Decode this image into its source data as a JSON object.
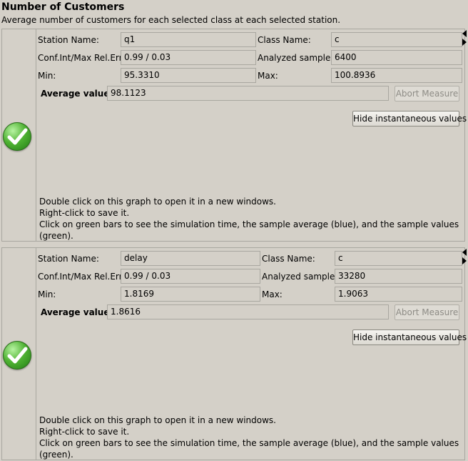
{
  "header": {
    "title": "Number of Customers",
    "subtitle": "Average number of customers for each selected class at each selected station."
  },
  "labels": {
    "station_name": "Station Name:",
    "class_name": "Class Name:",
    "conf_int": "Conf.Int/Max Rel.Err:",
    "analyzed_samples": "Analyzed samples:",
    "min": "Min:",
    "max": "Max:",
    "average_value": "Average value:"
  },
  "buttons": {
    "abort": "Abort Measure",
    "hide_values": "Hide instantaneous values"
  },
  "help": {
    "line1": "Double click on this graph to open it in a new windows.",
    "line2": "Right-click to save it.",
    "line3": "Click on green bars to see the simulation time, the sample average (blue), and the sample values (green)."
  },
  "panels": [
    {
      "status_icon": "green-check-icon",
      "station_name": "q1",
      "class_name": "c",
      "conf_int": "0.99 / 0.03",
      "analyzed_samples": "6400",
      "min": "95.3310",
      "max": "100.8936",
      "average_value": "98.1123"
    },
    {
      "status_icon": "green-check-icon",
      "station_name": "delay",
      "class_name": "c",
      "conf_int": "0.99 / 0.03",
      "analyzed_samples": "33280",
      "min": "1.8169",
      "max": "1.9063",
      "average_value": "1.8616"
    }
  ]
}
